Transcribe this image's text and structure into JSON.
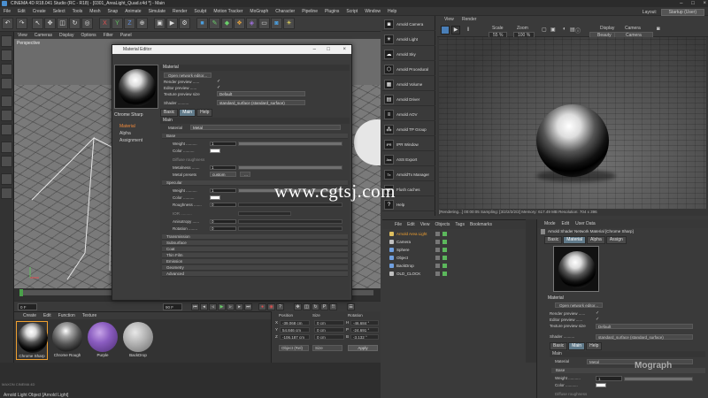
{
  "window": {
    "title": "CINEMA 4D R18.041 Studio (RC - R18) - [0301_AreaLight_Quad.c4d *] - Main",
    "controls": [
      "–",
      "□",
      "×"
    ]
  },
  "menubar": {
    "items": [
      "File",
      "Edit",
      "Create",
      "Select",
      "Tools",
      "Mesh",
      "Snap",
      "Animate",
      "Simulate",
      "Render",
      "Sculpt",
      "Motion Tracker",
      "MoGraph",
      "Character",
      "Pipeline",
      "Plugins",
      "Script",
      "Window",
      "Help"
    ],
    "layout_label": "Layout:",
    "layout_value": "Startup (User)"
  },
  "viewport": {
    "menu": [
      "View",
      "Cameras",
      "Display",
      "Options",
      "Filter",
      "Panel"
    ],
    "label": "Perspective"
  },
  "material_editor": {
    "title": "Material Editor",
    "material_name": "Chrome Sharp",
    "channels": [
      {
        "label": "Material",
        "active": true
      },
      {
        "label": "Alpha",
        "active": false
      },
      {
        "label": "Assignment",
        "active": false
      }
    ],
    "section_material": "Material",
    "open_network": "Open network editor...",
    "render_preview": "Render preview ......",
    "editor_preview": "Editor preview ......",
    "texture_preview": "Texture preview size",
    "texture_preview_value": "Default",
    "shader_label": "Shader ..........",
    "shader_value": "standard_surface (standard_surface)",
    "tabs": [
      "Basic",
      "Main",
      "Help"
    ],
    "main_label": "Main",
    "material_label": "Material",
    "material_value": "Metal",
    "base_group": "Base",
    "weight_label": "Weight ..........",
    "weight_value": "1",
    "color_label": "Color ..........",
    "diffuse_roughness": "Diffuse roughness",
    "metalness_label": "Metalness .......",
    "metalness_value": "1",
    "metal_presets": "Metal presets",
    "metal_presets_value": "custom",
    "specular_group": "Specular",
    "spec_weight_label": "Weight ..........",
    "spec_weight_value": "1",
    "spec_color_label": "Color ..........",
    "spec_roughness_label": "Roughness .......",
    "spec_roughness_value": "0",
    "ior_label": "IOR ..........",
    "anisotropy_label": "Anisotropy ......",
    "anisotropy_value": "0",
    "rotation_label": "Rotation ........",
    "rotation_value": "0",
    "groups": [
      "Transmission",
      "Subsurface",
      "Coat",
      "Thin Film",
      "Emission",
      "Geometry",
      "Advanced"
    ]
  },
  "transport": {
    "frame_start": "0 F",
    "frame_end": "90 F",
    "frame_current": "0 F"
  },
  "material_manager": {
    "menu": [
      "Create",
      "Edit",
      "Function",
      "Texture"
    ],
    "materials": [
      {
        "name": "Chrome Sharp",
        "selected": true
      },
      {
        "name": "Chrome Rough",
        "selected": false
      },
      {
        "name": "Purple",
        "selected": false
      },
      {
        "name": "BackDrop",
        "selected": false
      }
    ]
  },
  "coordinates": {
    "headers": [
      "Position",
      "Size",
      "Rotation"
    ],
    "rows": [
      {
        "axis": "X",
        "pos": "-39.068 cm",
        "size": "0 cm",
        "rotlabel": "H",
        "rot": "-46.684 °"
      },
      {
        "axis": "Y",
        "pos": "54.846 cm",
        "size": "0 cm",
        "rotlabel": "P",
        "rot": "-24.691 °"
      },
      {
        "axis": "Z",
        "pos": "-106.187 cm",
        "size": "0 cm",
        "rotlabel": "B",
        "rot": "-3.132 °"
      }
    ],
    "mode_object": "Object (Rel)",
    "mode_size": "Size",
    "apply": "Apply"
  },
  "status": {
    "text": "Arnold Light Object [Arnold Light]",
    "brand": "MAXON CINEMA 4D"
  },
  "arnold_shelf": {
    "items": [
      "Arnold Camera",
      "Arnold Light",
      "Arnold Sky",
      "Arnold Procedural",
      "Arnold Volume",
      "Arnold Driver",
      "Arnold AOV",
      "Arnold TP Group",
      "IPR Window",
      "ASS Export",
      "ArnoldTx Manager",
      "Flush caches",
      "Help"
    ]
  },
  "ipr": {
    "menu": [
      "View",
      "Render"
    ],
    "scale_label": "Scale",
    "scale_value": "55 %",
    "zoom_label": "Zoom",
    "zoom_value": "100 %",
    "display_label": "Display",
    "display_value": "Beauty",
    "camera_label": "Camera",
    "camera_value": "Camera",
    "status": "[Rendering...]  00:00:05   Sampling: [3/2/2/2/2/2]   Memory: 617.49 MB   Resolution: 704 x 396"
  },
  "watermark": "www.cgtsj.com",
  "objects": {
    "menu": [
      "File",
      "Edit",
      "View",
      "Objects",
      "Tags",
      "Bookmarks"
    ],
    "rows": [
      {
        "name": "Arnold Area Light",
        "color": "#e0c060",
        "selected": true
      },
      {
        "name": "Camera",
        "color": "#c0c0c0",
        "selected": false
      },
      {
        "name": "Sphere",
        "color": "#70a0e0",
        "selected": false
      },
      {
        "name": "Object",
        "color": "#70a0e0",
        "selected": false
      },
      {
        "name": "BackDrop",
        "color": "#70a0e0",
        "selected": false
      },
      {
        "name": "OLD_CLOCK",
        "color": "#c0c0c0",
        "selected": false
      }
    ]
  },
  "attributes": {
    "menu": [
      "Mode",
      "Edit",
      "User Data"
    ],
    "title": "Arnold Shader Network Material [Chrome Sharp]",
    "tabs": [
      "Basic",
      "Material",
      "Alpha",
      "Assign"
    ],
    "section": "Material",
    "open_network": "Open network editor...",
    "render_preview": "Render preview ......",
    "editor_preview": "Editor preview ......",
    "texture_preview": "Texture preview size",
    "texture_preview_value": "Default",
    "shader_label": "Shader ..........",
    "shader_value": "standard_surface (standard_surface)",
    "subtabs": [
      "Basic",
      "Main",
      "Help"
    ],
    "main_label": "Main",
    "material_label": "Material",
    "material_value": "Metal",
    "base_group": "Base",
    "weight_label": "Weight ...........",
    "weight_value": "1",
    "color_label": "Color ...........",
    "diffuse_roughness": "Diffuse roughness",
    "mograph_logo": "Mograph"
  }
}
